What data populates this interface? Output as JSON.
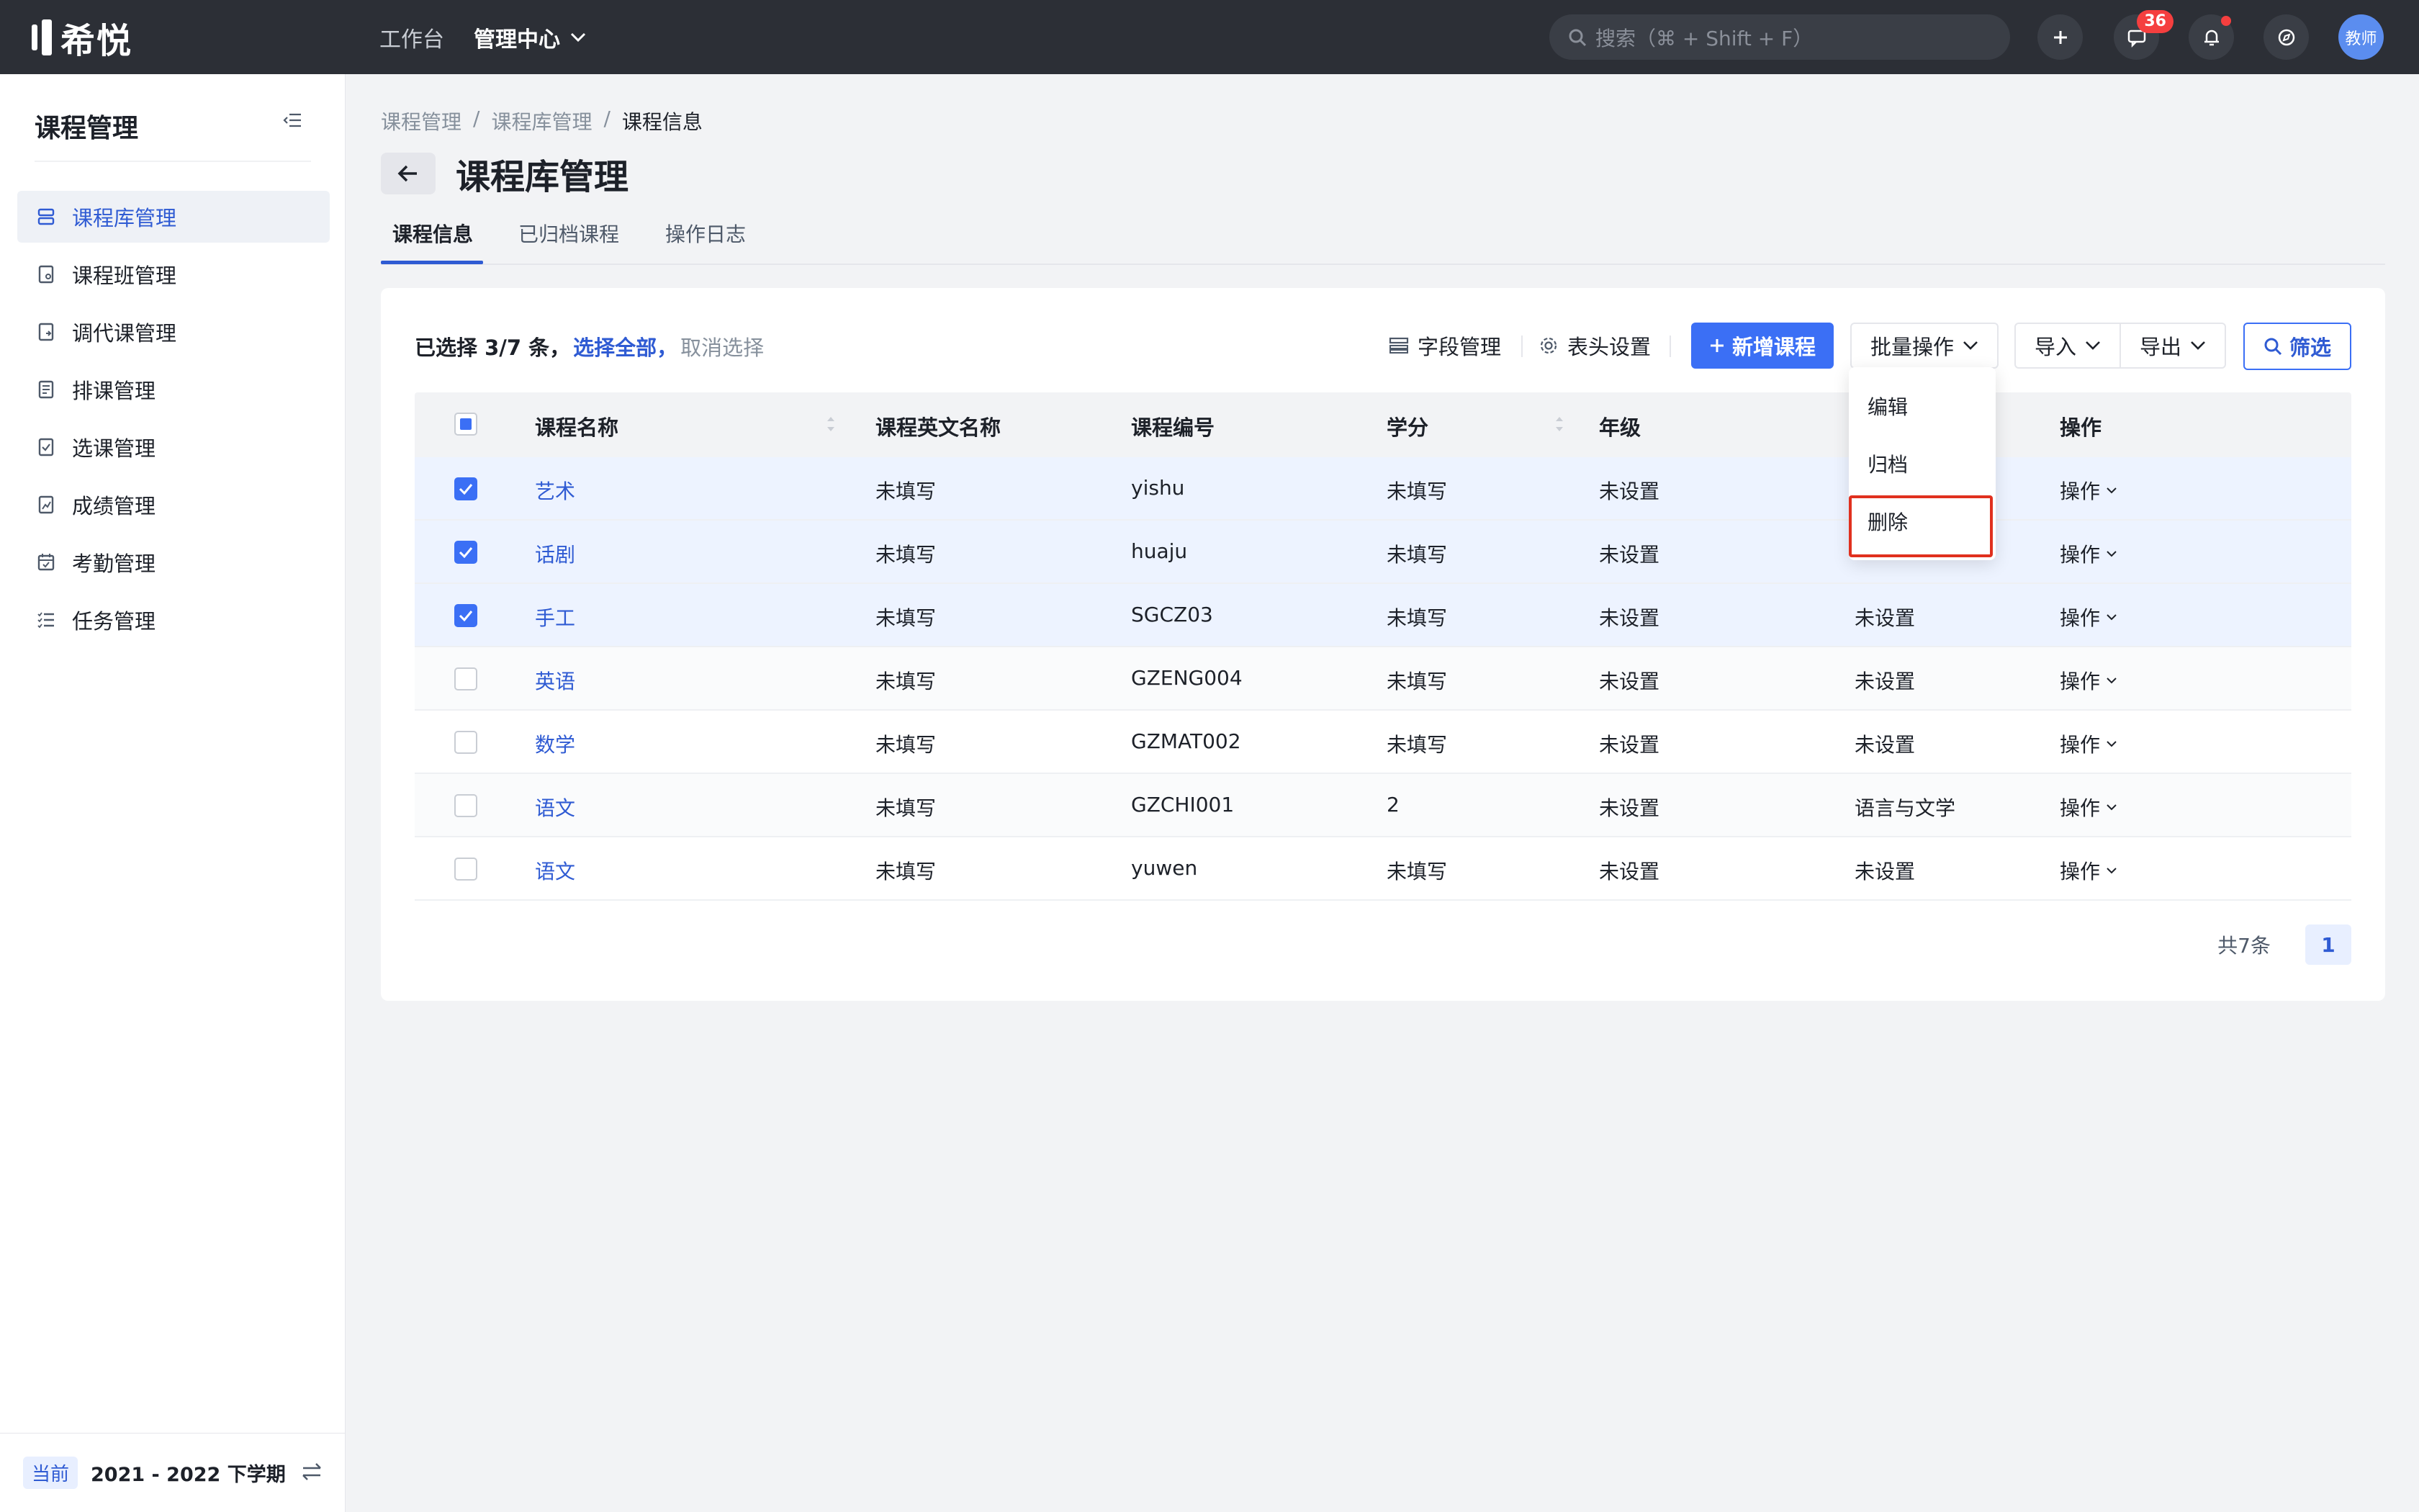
{
  "topbar": {
    "logo_text": "希悦",
    "nav": [
      "工作台",
      "管理中心"
    ],
    "search_placeholder": "搜索（⌘ + Shift + F）",
    "messages_badge": "36",
    "avatar_label": "教师"
  },
  "sidebar": {
    "title": "课程管理",
    "items": [
      {
        "label": "课程库管理",
        "icon": "database-icon",
        "active": true
      },
      {
        "label": "课程班管理",
        "icon": "class-book-icon"
      },
      {
        "label": "调代课管理",
        "icon": "swap-book-icon"
      },
      {
        "label": "排课管理",
        "icon": "schedule-icon"
      },
      {
        "label": "选课管理",
        "icon": "checklist-icon"
      },
      {
        "label": "成绩管理",
        "icon": "grade-chart-icon"
      },
      {
        "label": "考勤管理",
        "icon": "calendar-check-icon"
      },
      {
        "label": "任务管理",
        "icon": "task-list-icon"
      }
    ],
    "footer": {
      "tag": "当前",
      "term": "2021 - 2022 下学期"
    }
  },
  "breadcrumb": [
    "课程管理",
    "课程库管理",
    "课程信息"
  ],
  "page_title": "课程库管理",
  "tabs": [
    "课程信息",
    "已归档课程",
    "操作日志"
  ],
  "toolbar": {
    "selection_prefix": "已选择 3/7 条，",
    "select_all": "选择全部，",
    "cancel_select": "取消选择",
    "field_manage": "字段管理",
    "header_settings": "表头设置",
    "add_course": "新增课程",
    "batch_ops": "批量操作",
    "import": "导入",
    "export": "导出",
    "filter": "筛选"
  },
  "table": {
    "columns": [
      "课程名称",
      "课程英文名称",
      "课程编号",
      "学分",
      "年级",
      "",
      "操作"
    ],
    "rows": [
      {
        "name": "艺术",
        "en": "未填写",
        "code": "yishu",
        "credit": "未填写",
        "grade": "未设置",
        "extra": "",
        "op": "操作",
        "checked": true
      },
      {
        "name": "话剧",
        "en": "未填写",
        "code": "huaju",
        "credit": "未填写",
        "grade": "未设置",
        "extra": "",
        "op": "操作",
        "checked": true
      },
      {
        "name": "手工",
        "en": "未填写",
        "code": "SGCZ03",
        "credit": "未填写",
        "grade": "未设置",
        "extra": "未设置",
        "op": "操作",
        "checked": true
      },
      {
        "name": "英语",
        "en": "未填写",
        "code": "GZENG004",
        "credit": "未填写",
        "grade": "未设置",
        "extra": "未设置",
        "op": "操作",
        "checked": false
      },
      {
        "name": "数学",
        "en": "未填写",
        "code": "GZMAT002",
        "credit": "未填写",
        "grade": "未设置",
        "extra": "未设置",
        "op": "操作",
        "checked": false
      },
      {
        "name": "语文",
        "en": "未填写",
        "code": "GZCHI001",
        "credit": "2",
        "grade": "未设置",
        "extra": "语言与文学",
        "op": "操作",
        "checked": false
      },
      {
        "name": "语文",
        "en": "未填写",
        "code": "yuwen",
        "credit": "未填写",
        "grade": "未设置",
        "extra": "未设置",
        "op": "操作",
        "checked": false
      }
    ]
  },
  "pagination": {
    "total": "共7条",
    "page": "1"
  },
  "batch_menu": [
    "编辑",
    "归档",
    "删除"
  ],
  "colors": {
    "topbar": "#2c2f36",
    "accent": "#3b6ff5",
    "link": "#2f5bd3",
    "highlight": "#e0301e"
  }
}
